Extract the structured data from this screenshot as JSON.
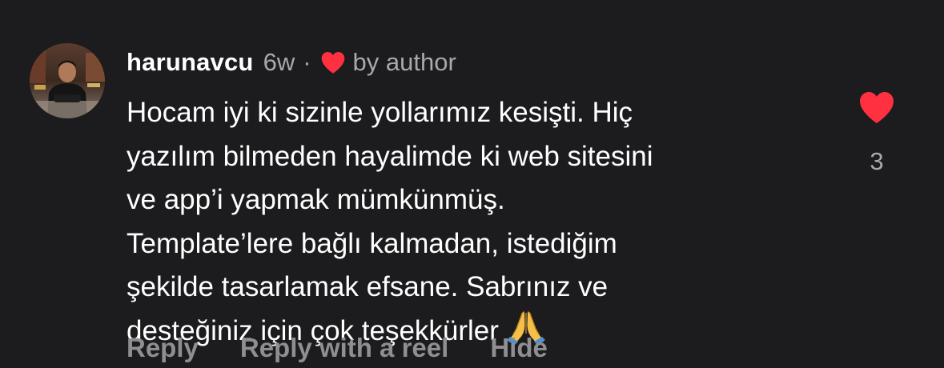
{
  "comment": {
    "username": "harunavcu",
    "time": "6w",
    "separator": "·",
    "by_author": "by author",
    "text_lines": [
      "Hocam iyi ki sizinle yollarımız kesişti. Hiç",
      "yazılım bilmeden hayalimde ki web sitesini",
      "ve app’i yapmak mümkünmüş.",
      "Template’lere bağlı kalmadan, istediğim",
      "şekilde tasarlamak efsane. Sabrınız ve",
      "desteğiniz için çok teşekkürler"
    ],
    "emoji": "folded-hands-emoji",
    "like_count": "3",
    "liked": true
  },
  "actions": {
    "reply": "Reply",
    "reply_with_reel": "Reply with a reel",
    "hide": "Hide"
  },
  "icons": {
    "author_like": "heart-icon",
    "like_button": "heart-icon"
  },
  "colors": {
    "background": "#1c1c1e",
    "heart": "#ff3040",
    "secondary_text": "#a8a8ad",
    "action_text": "#8e8e93"
  }
}
